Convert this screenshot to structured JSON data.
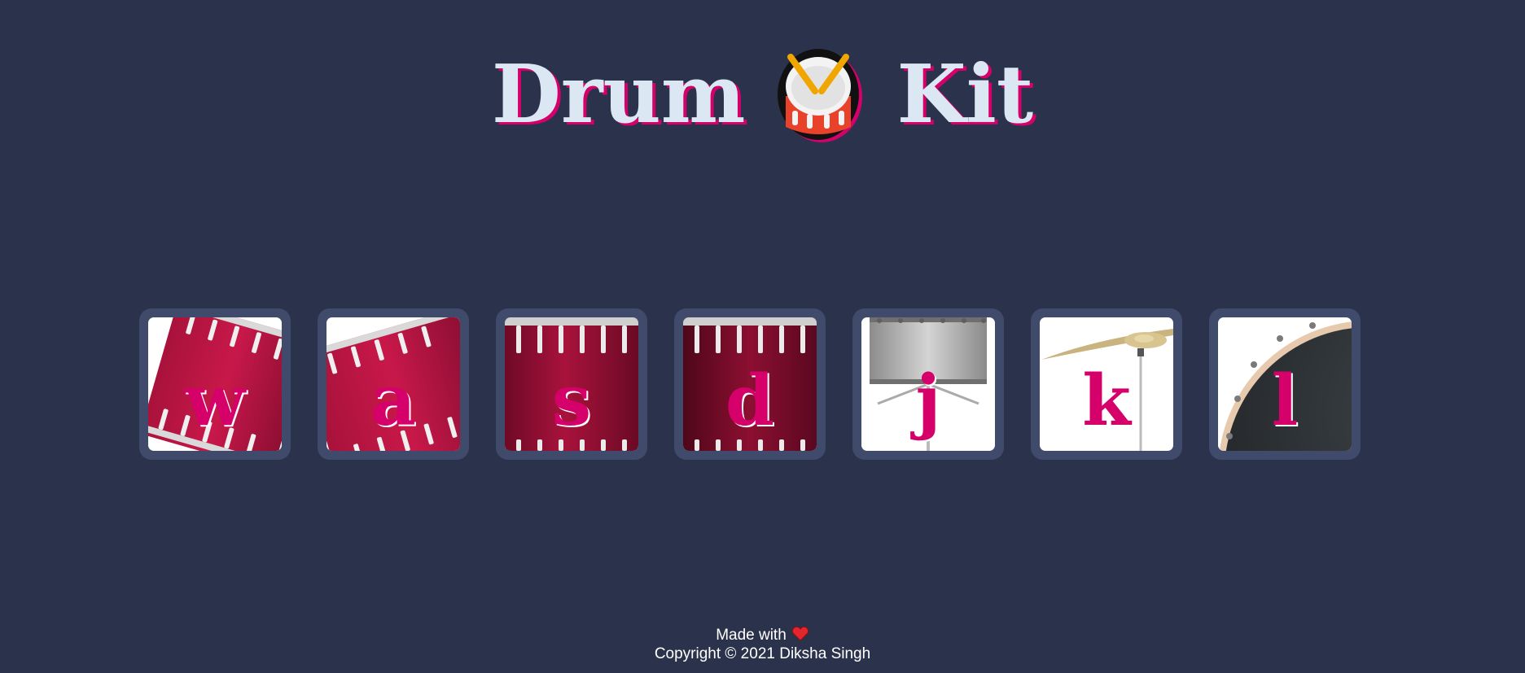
{
  "header": {
    "title_left": "Drum",
    "title_right": "Kit",
    "emoji_icon": "drum-emoji-icon"
  },
  "drums": [
    {
      "key": "w",
      "art": "tilted-left-tom"
    },
    {
      "key": "a",
      "art": "tilted-right-tom"
    },
    {
      "key": "s",
      "art": "floor-tom"
    },
    {
      "key": "d",
      "art": "bass-drum-side"
    },
    {
      "key": "j",
      "art": "snare-drum"
    },
    {
      "key": "k",
      "art": "crash-cymbal"
    },
    {
      "key": "l",
      "art": "kick-drum"
    }
  ],
  "footer": {
    "made_with": "Made with",
    "heart_icon": "heart-icon",
    "copyright": "Copyright © 2021 Diksha Singh"
  },
  "colors": {
    "background": "#2b324b",
    "button_frame": "#404a6b",
    "accent": "#d6006b",
    "title_text": "#dbe8f4"
  }
}
